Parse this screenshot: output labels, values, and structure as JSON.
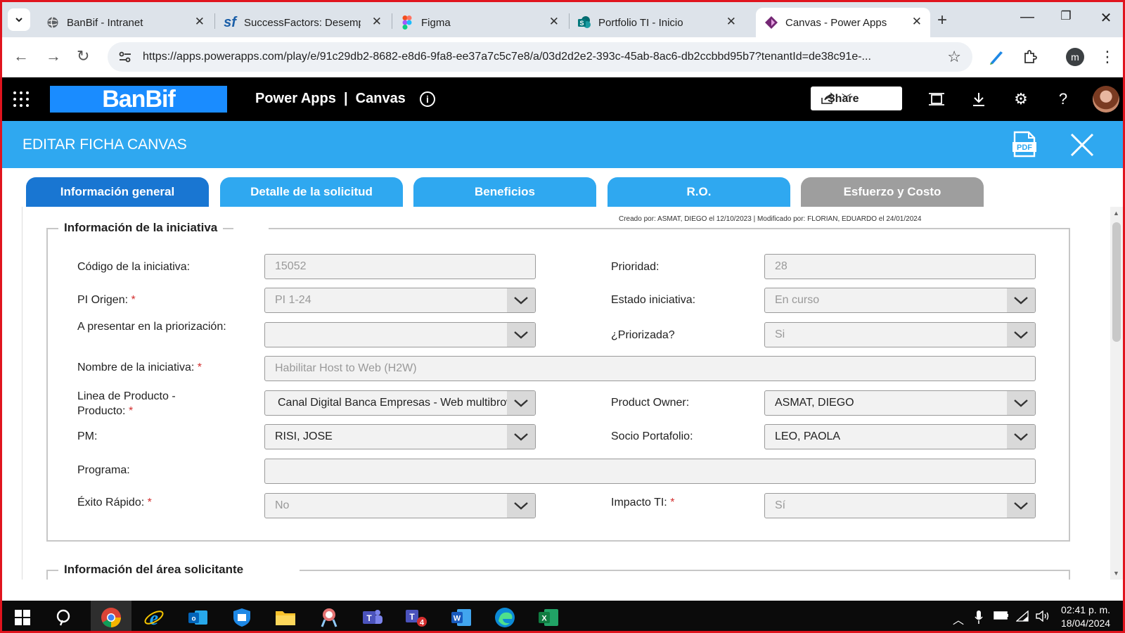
{
  "browser": {
    "tabs": [
      {
        "title": "BanBif - Intranet",
        "icon": "globe-icon"
      },
      {
        "title": "SuccessFactors: Desempeño",
        "icon": "successfactors-icon"
      },
      {
        "title": "Figma",
        "icon": "figma-icon"
      },
      {
        "title": "Portfolio TI - Inicio",
        "icon": "sharepoint-icon"
      },
      {
        "title": "Canvas - Power Apps",
        "icon": "powerapps-icon"
      }
    ],
    "url": "https://apps.powerapps.com/play/e/91c29db2-8682-e8d6-9fa8-ee37a7c5c7e8/a/03d2d2e2-393c-45ab-8ac6-db2ccbbd95b7?tenantId=de38c91e-...",
    "profile_initial": "m"
  },
  "header": {
    "logo_text": "BanBif",
    "app_title": "Power Apps  |  Canvas",
    "share_label": "Share"
  },
  "app": {
    "title": "EDITAR FICHA CANVAS",
    "pdf_label": "PDF",
    "tabs": [
      {
        "label": "Información general"
      },
      {
        "label": "Detalle de la solicitud"
      },
      {
        "label": "Beneficios"
      },
      {
        "label": "R.O."
      },
      {
        "label": "Esfuerzo y Costo"
      }
    ],
    "meta": "Creado por: ASMAT, DIEGO el 12/10/2023 | Modificado por: FLORIAN, EDUARDO el 24/01/2024",
    "section1_title": "Información de la iniciativa",
    "section2_title": "Información del área solicitante",
    "fields": {
      "codigo": {
        "label": "Código de la iniciativa:",
        "value": "15052"
      },
      "prioridad": {
        "label": "Prioridad:",
        "value": "28"
      },
      "pi_origen": {
        "label": "PI Origen:",
        "value": "PI 1-24"
      },
      "estado": {
        "label": "Estado iniciativa:",
        "value": "En curso"
      },
      "presentar": {
        "label": "A presentar en la priorización:",
        "value": ""
      },
      "priorizada": {
        "label": "¿Priorizada?",
        "value": "Si"
      },
      "nombre": {
        "label": "Nombre de la iniciativa:",
        "value": "Habilitar Host to Web (H2W)"
      },
      "linea_1": {
        "label": "Linea de Producto -"
      },
      "linea_2": {
        "label": "Producto:",
        "value": "Canal Digital Banca Empresas - Web multibrowser"
      },
      "product_owner": {
        "label": "Product Owner:",
        "value": "ASMAT, DIEGO"
      },
      "pm": {
        "label": "PM:",
        "value": "RISI, JOSE"
      },
      "socio": {
        "label": "Socio Portafolio:",
        "value": "LEO, PAOLA"
      },
      "programa": {
        "label": "Programa:",
        "value": ""
      },
      "exito": {
        "label": "Éxito Rápido:",
        "value": "No"
      },
      "impacto": {
        "label": "Impacto TI:",
        "value": "Sí"
      }
    },
    "required_mark": "*"
  },
  "taskbar": {
    "teams_badge": "4",
    "time": "02:41 p. m.",
    "date": "18/04/2024"
  },
  "colors": {
    "accent": "#2fa8f0",
    "primary_tab": "#1976d2",
    "disabled_tab": "#9e9e9e",
    "brand": "#1a8cff",
    "required": "#d32f2f"
  }
}
